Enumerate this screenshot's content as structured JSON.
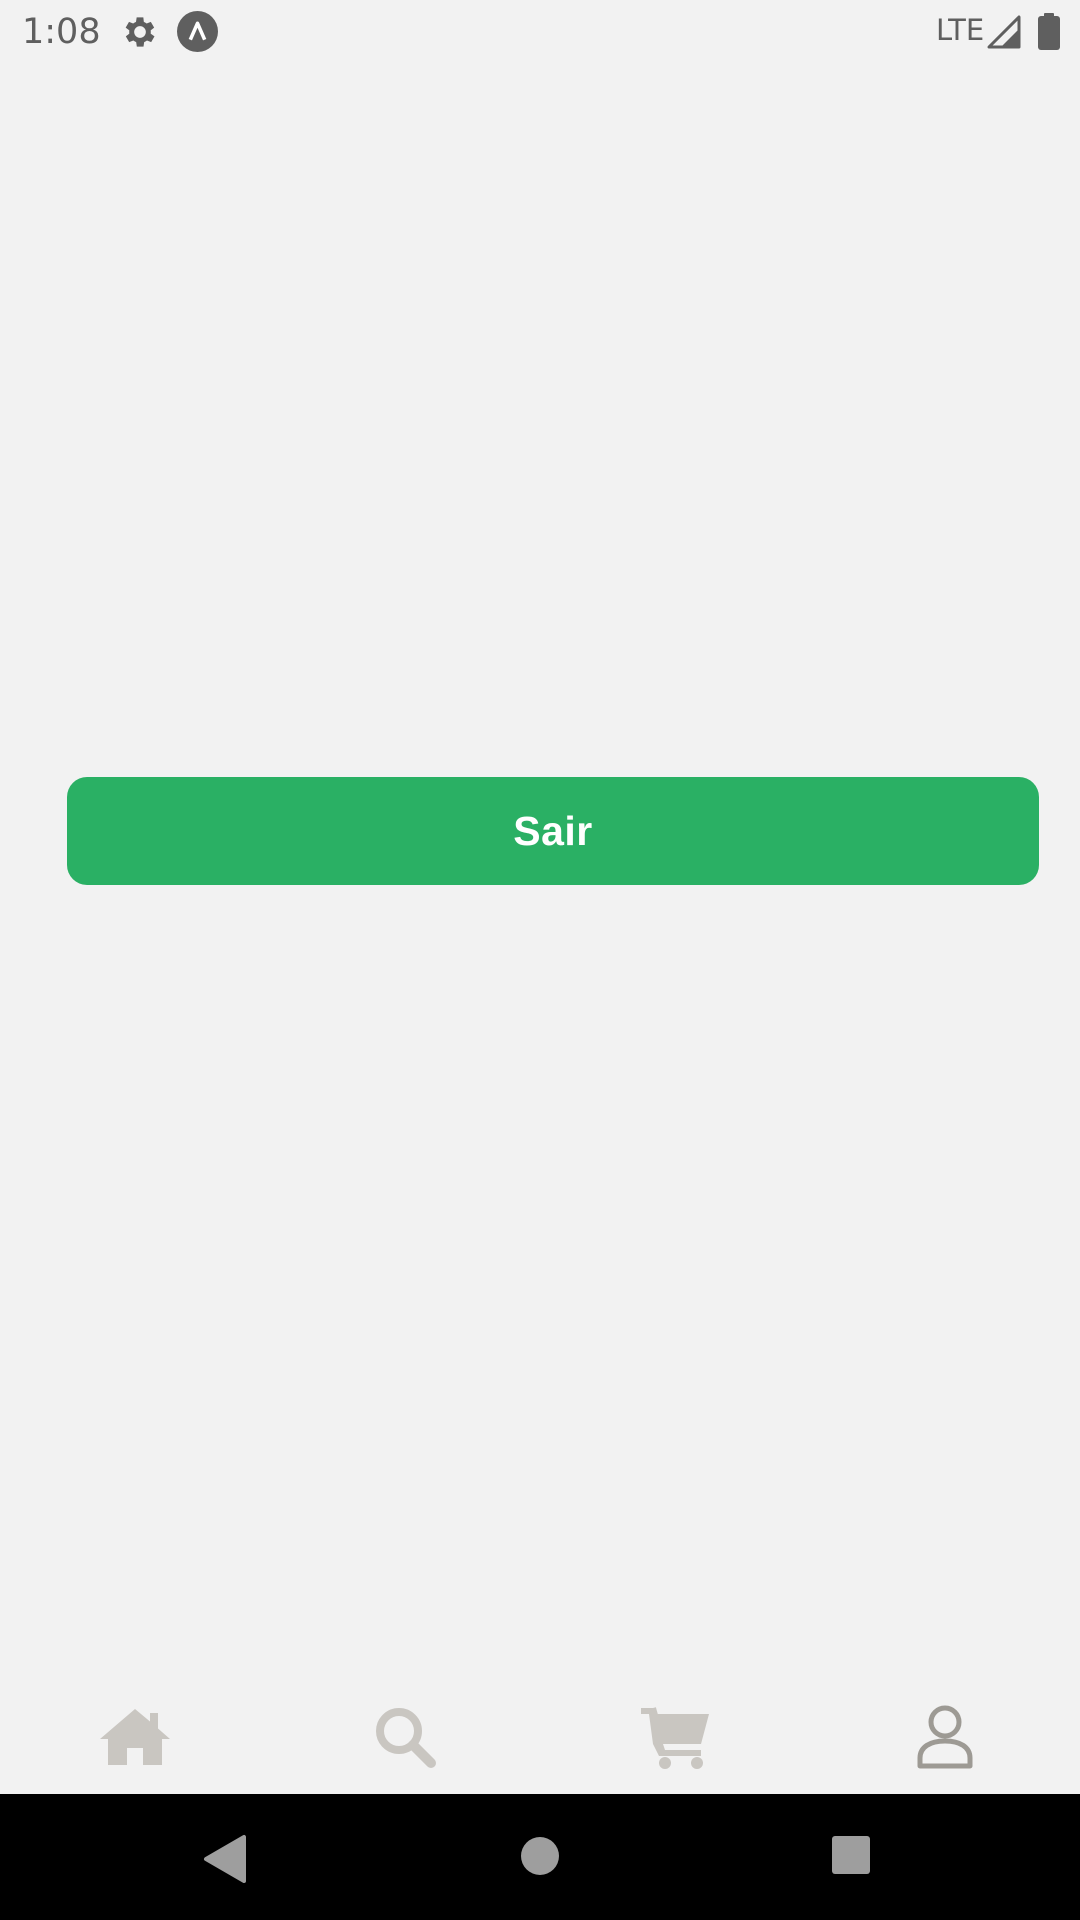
{
  "status_bar": {
    "time": "1:08",
    "network": "LTE",
    "icons": [
      "gear-icon",
      "app-notification-icon",
      "signal-icon",
      "battery-icon"
    ]
  },
  "main": {
    "logout_button": {
      "label": "Sair",
      "color": "#2ab064"
    }
  },
  "tab_bar": {
    "tabs": [
      {
        "name": "home",
        "icon": "home-icon",
        "color": "#c9c6c1"
      },
      {
        "name": "search",
        "icon": "search-icon",
        "color": "#c9c6c1"
      },
      {
        "name": "cart",
        "icon": "cart-icon",
        "color": "#c9c6c1"
      },
      {
        "name": "profile",
        "icon": "user-icon",
        "color": "#9d9a94",
        "active": true
      }
    ]
  },
  "nav_bar": {
    "buttons": [
      "back-icon",
      "home-circle-icon",
      "recents-icon"
    ]
  }
}
